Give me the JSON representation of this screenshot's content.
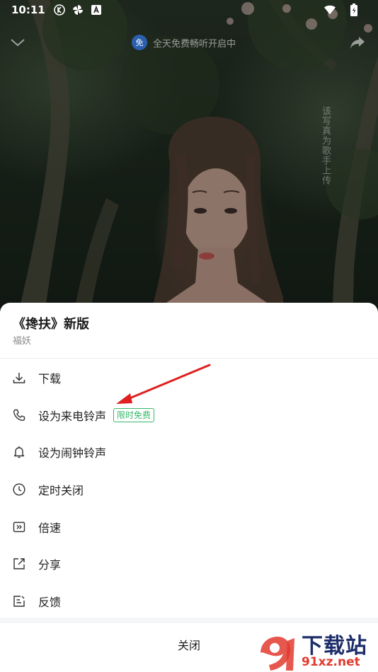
{
  "status_bar": {
    "time": "10:11",
    "icons": [
      "k-app-icon",
      "pinwheel-icon",
      "a-app-icon",
      "wifi-icon",
      "battery-icon"
    ]
  },
  "player": {
    "free_badge": "免",
    "free_text": "全天免费畅听开启中",
    "vertical_text": "该写真为歌手上传"
  },
  "sheet": {
    "song_title": "《搀扶》新版",
    "artist": "福妖",
    "menu": [
      {
        "label": "下载",
        "icon": "download-icon"
      },
      {
        "label": "设为来电铃声",
        "icon": "phone-icon",
        "tag": "限时免费"
      },
      {
        "label": "设为闹钟铃声",
        "icon": "bell-icon"
      },
      {
        "label": "定时关闭",
        "icon": "timer-icon"
      },
      {
        "label": "倍速",
        "icon": "speed-icon"
      },
      {
        "label": "分享",
        "icon": "share-icon"
      },
      {
        "label": "反馈",
        "icon": "feedback-icon"
      }
    ],
    "close_label": "关闭"
  },
  "watermark": {
    "brand": "下载站",
    "domain": "91xz.net"
  },
  "colors": {
    "tag_green": "#35b96a",
    "annotation_red": "#e02020",
    "free_badge_blue": "#2b5fb0"
  }
}
